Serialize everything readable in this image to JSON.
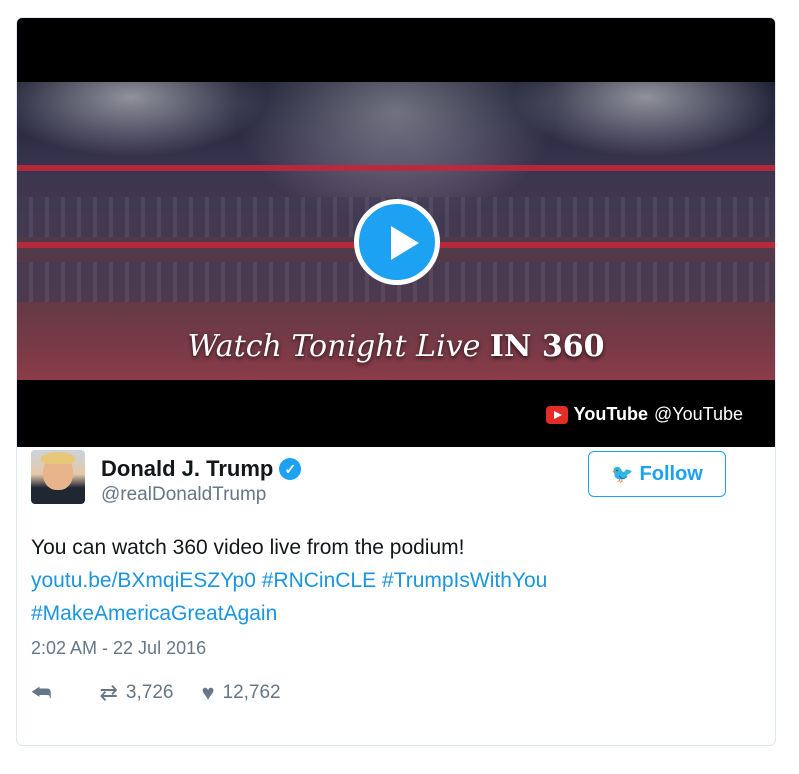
{
  "video": {
    "overlay_part1": "Watch Tonight Live",
    "overlay_part2": "IN 360",
    "source_name": "YouTube",
    "source_handle": "@YouTube",
    "icon": "play-icon"
  },
  "author": {
    "name": "Donald J. Trump",
    "handle": "@realDonaldTrump",
    "verified_icon": "✓"
  },
  "follow_label": "Follow",
  "tweet": {
    "text_line1": "You can watch 360 video live from the podium!",
    "link": "youtu.be/BXmqiESZYp0",
    "hashtag1": "#RNCinCLE",
    "hashtag2": "#TrumpIsWithYou",
    "hashtag3": "#MakeAmericaGreatAgain",
    "timestamp": "2:02 AM - 22 Jul 2016"
  },
  "stats": {
    "retweets": "3,726",
    "likes": "12,762"
  },
  "colors": {
    "accent": "#1da1f2",
    "link": "#1b95e0",
    "muted": "#657786"
  }
}
